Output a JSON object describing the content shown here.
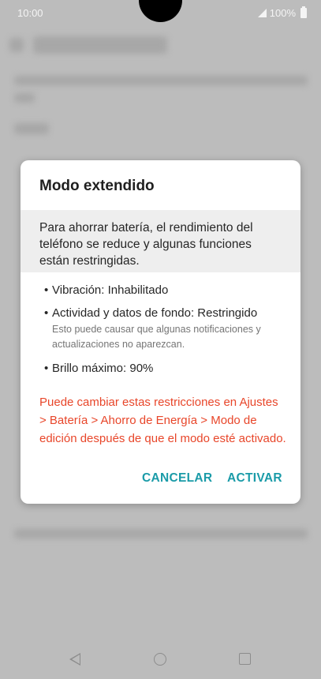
{
  "status_bar": {
    "time": "10:00",
    "battery": "100%"
  },
  "dialog": {
    "title": "Modo extendido",
    "info": "Para ahorrar batería, el rendimiento del teléfono se reduce y algunas funciones están restringidas.",
    "bullets": [
      {
        "text": "Vibración: Inhabilitado",
        "note": ""
      },
      {
        "text": "Actividad y datos de fondo: Restringido",
        "note": "Esto puede causar que algunas notificaciones y actualizaciones no aparezcan."
      },
      {
        "text": "Brillo máximo: 90%",
        "note": ""
      }
    ],
    "warning": "Puede cambiar estas restricciones en Ajustes > Batería > Ahorro de Energía > Modo de edición después de que el modo esté activado.",
    "cancel_label": "CANCELAR",
    "activate_label": "ACTIVAR"
  },
  "colors": {
    "accent": "#1a9ba8",
    "warning": "#e8462a"
  },
  "icons": {
    "signal": "signal-icon",
    "battery": "battery-icon",
    "nav_back": "back-icon",
    "nav_home": "home-icon",
    "nav_recent": "recents-icon"
  }
}
